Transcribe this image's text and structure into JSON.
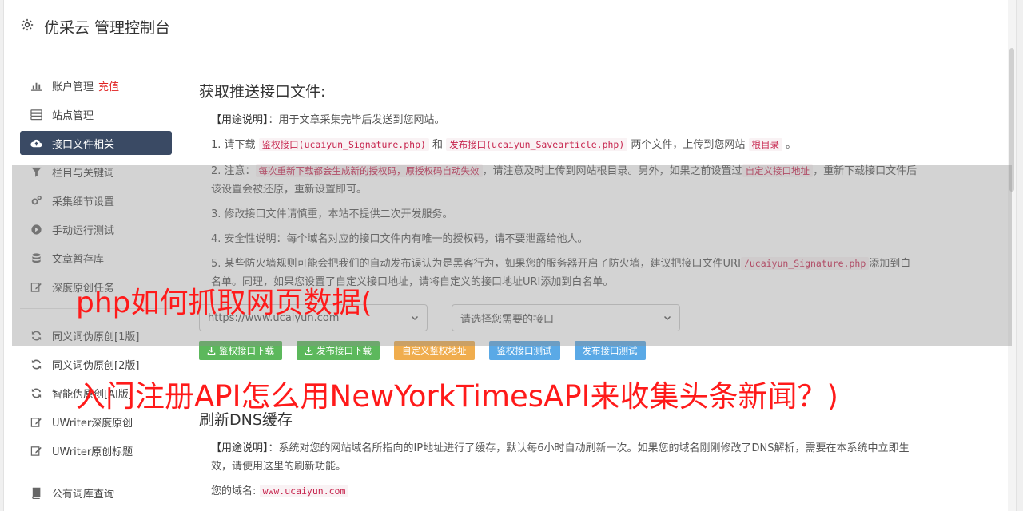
{
  "header": {
    "title": "优采云 管理控制台",
    "icon": "gear-icon"
  },
  "sidebar": {
    "items": [
      {
        "label": "账户管理",
        "badge": "充值",
        "icon": "bar-chart-icon"
      },
      {
        "label": "站点管理",
        "icon": "server-icon"
      },
      {
        "label": "接口文件相关",
        "icon": "cloud-upload-icon",
        "active": true
      },
      {
        "label": "栏目与关键词",
        "icon": "filter-icon"
      },
      {
        "label": "采集细节设置",
        "icon": "gears-icon"
      },
      {
        "label": "手动运行测试",
        "icon": "play-circle-icon"
      },
      {
        "label": "文章暂存库",
        "icon": "database-icon"
      },
      {
        "label": "深度原创任务",
        "icon": "edit-icon"
      },
      {
        "label": "同义词伪原创[1版]",
        "icon": "refresh-icon"
      },
      {
        "label": "同义词伪原创[2版]",
        "icon": "refresh-icon"
      },
      {
        "label": "智能伪原创[AI版]",
        "icon": "refresh-icon"
      },
      {
        "label": "UWriter深度原创",
        "icon": "edit-icon"
      },
      {
        "label": "UWriter原创标题",
        "icon": "edit-icon"
      },
      {
        "label": "公有词库查询",
        "icon": "book-icon"
      }
    ]
  },
  "section1": {
    "title": "获取推送接口文件:",
    "usage_label": "【用途说明】",
    "usage_text": "：用于文章采集完毕后发送到您网站。",
    "line1": {
      "pre": "1. 请下载 ",
      "code1": "鉴权接口(ucaiyun_Signature.php)",
      "mid1": " 和 ",
      "code2": "发布接口(ucaiyun_Savearticle.php)",
      "mid2": " 两个文件，上传到您网站 ",
      "code3": "根目录",
      "post": " 。"
    },
    "line2": {
      "pre": "2. 注意：",
      "code1": "每次重新下载都会生成新的授权码，原授权码自动失效",
      "mid": "，请注意及时上传到网站根目录。另外，如果之前设置过",
      "code2": "自定义接口地址",
      "post": "，重新下载接口文件后该设置会被还原，重新设置即可。"
    },
    "line3": "3. 修改接口文件请慎重，本站不提供二次开发服务。",
    "line4": "4. 安全性说明：每个域名对应的接口文件内有唯一的授权码，请不要泄露给他人。",
    "line5": {
      "pre": "5. 某些防火墙规则可能会把我们的自动发布误认为是黑客行为，如果您的服务器开启了防火墙，建议把接口文件URI",
      "code1": "/ucaiyun_Signature.php",
      "post": "添加到白名单。同理，如果您设置了自定义接口地址，请将自定义的接口地址URI添加到白名单。"
    },
    "select_site": "https://www.ucaiyun.com",
    "select_api": "请选择您需要的接口",
    "buttons": {
      "auth_download": "鉴权接口下载",
      "publish_download": "发布接口下载",
      "custom_auth_url": "自定义鉴权地址",
      "auth_test": "鉴权接口测试",
      "publish_test": "发布接口测试"
    }
  },
  "section2": {
    "title": "刷新DNS缓存",
    "usage_label": "【用途说明】",
    "usage_text": "：系统对您的网站域名所指向的IP地址进行了缓存，默认每6小时自动刷新一次。如果您的域名刚刚修改了DNS解析，需要在本系统中立即生效，请使用这里的刷新功能。",
    "domain_label": "您的域名:",
    "domain_value": "www.ucaiyun.com"
  },
  "watermark": {
    "line1": "php如何抓取网页数据(",
    "line2": "入门注册API怎么用NewYorkTimesAPI来收集头条新闻？)"
  },
  "colors": {
    "active_bg": "#3a4a64",
    "green": "#5cb85c",
    "orange": "#f0ad4e",
    "blue": "#5aa9e6",
    "watermark": "#ff1a1a"
  }
}
